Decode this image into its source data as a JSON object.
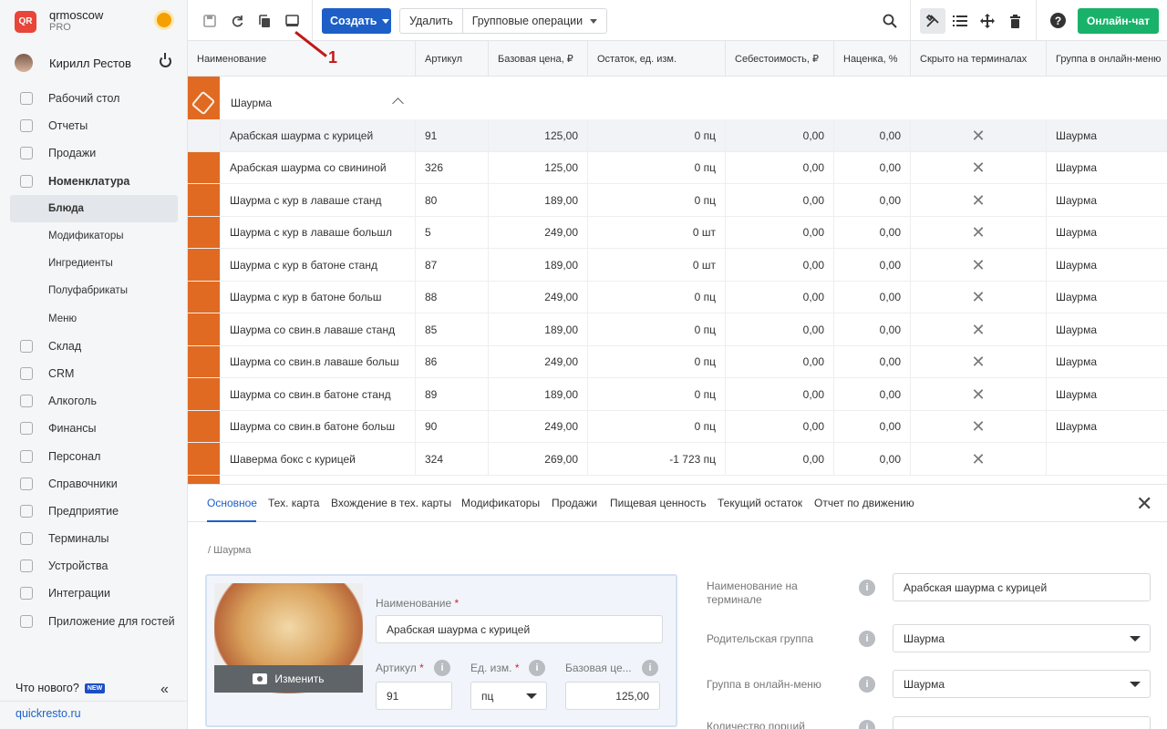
{
  "app": {
    "brand_name": "qrmoscow",
    "brand_plan": "PRO",
    "logo_text": "QR",
    "user_name": "Кирилл Рестов"
  },
  "sidebar": {
    "items": [
      {
        "label": "Рабочий стол",
        "icon": "desktop-icon"
      },
      {
        "label": "Отчеты",
        "icon": "reports-icon"
      },
      {
        "label": "Продажи",
        "icon": "basket-icon"
      },
      {
        "label": "Номенклатура",
        "icon": "tag-icon"
      },
      {
        "label": "Блюда",
        "sub": true,
        "active": true
      },
      {
        "label": "Модификаторы",
        "sub": true
      },
      {
        "label": "Ингредиенты",
        "sub": true
      },
      {
        "label": "Полуфабрикаты",
        "sub": true
      },
      {
        "label": "Меню",
        "sub": true
      },
      {
        "label": "Склад",
        "icon": "warehouse-icon"
      },
      {
        "label": "CRM",
        "icon": "crm-icon"
      },
      {
        "label": "Алкоголь",
        "icon": "glass-icon"
      },
      {
        "label": "Финансы",
        "icon": "wallet-icon"
      },
      {
        "label": "Персонал",
        "icon": "people-icon"
      },
      {
        "label": "Справочники",
        "icon": "book-icon"
      },
      {
        "label": "Предприятие",
        "icon": "store-icon"
      },
      {
        "label": "Терминалы",
        "icon": "terminal-icon"
      },
      {
        "label": "Устройства",
        "icon": "printer-icon"
      },
      {
        "label": "Интеграции",
        "icon": "infinity-icon"
      },
      {
        "label": "Приложение для гостей",
        "icon": "phone-icon"
      }
    ],
    "whats_new": "Что нового?",
    "new_badge": "NEW",
    "collapse": "«",
    "site_link": "quickresto.ru"
  },
  "toolbar": {
    "create_label": "Создать",
    "delete_label": "Удалить",
    "group_ops_label": "Групповые операции",
    "chat_label": "Онлайн-чат",
    "help": "?"
  },
  "annotation": {
    "label": "1"
  },
  "table": {
    "headers": [
      "Наименование",
      "Артикул",
      "Базовая цена, ₽",
      "Остаток, ед. изм.",
      "Себестоимость, ₽",
      "Наценка, %",
      "Скрыто на терминалах",
      "Группа в онлайн-меню"
    ],
    "group_label": "Шаурма",
    "rows": [
      {
        "name": "Арабская шаурма с курицей",
        "sku": "91",
        "price": "125,00",
        "stock": "0 пц",
        "cost": "0,00",
        "markup": "0,00",
        "group": "Шаурма"
      },
      {
        "name": "Арабская шаурма со свининой",
        "sku": "326",
        "price": "125,00",
        "stock": "0 пц",
        "cost": "0,00",
        "markup": "0,00",
        "group": "Шаурма"
      },
      {
        "name": "Шаурма с кур в лаваше станд",
        "sku": "80",
        "price": "189,00",
        "stock": "0 пц",
        "cost": "0,00",
        "markup": "0,00",
        "group": "Шаурма"
      },
      {
        "name": "Шаурма с кур в лаваше большл",
        "sku": "5",
        "price": "249,00",
        "stock": "0 шт",
        "cost": "0,00",
        "markup": "0,00",
        "group": "Шаурма"
      },
      {
        "name": "Шаурма с кур в батоне станд",
        "sku": "87",
        "price": "189,00",
        "stock": "0 шт",
        "cost": "0,00",
        "markup": "0,00",
        "group": "Шаурма"
      },
      {
        "name": "Шаурма с кур в батоне больш",
        "sku": "88",
        "price": "249,00",
        "stock": "0 пц",
        "cost": "0,00",
        "markup": "0,00",
        "group": "Шаурма"
      },
      {
        "name": "Шаурма со свин.в лаваше станд",
        "sku": "85",
        "price": "189,00",
        "stock": "0 пц",
        "cost": "0,00",
        "markup": "0,00",
        "group": "Шаурма"
      },
      {
        "name": "Шаурма со свин.в лаваше больш",
        "sku": "86",
        "price": "249,00",
        "stock": "0 пц",
        "cost": "0,00",
        "markup": "0,00",
        "group": "Шаурма"
      },
      {
        "name": "Шаурма со свин.в батоне станд",
        "sku": "89",
        "price": "189,00",
        "stock": "0 пц",
        "cost": "0,00",
        "markup": "0,00",
        "group": "Шаурма"
      },
      {
        "name": "Шаурма со свин.в батоне больш",
        "sku": "90",
        "price": "249,00",
        "stock": "0 пц",
        "cost": "0,00",
        "markup": "0,00",
        "group": "Шаурма"
      },
      {
        "name": "Шаверма бокс с курицей",
        "sku": "324",
        "price": "269,00",
        "stock": "-1 723 пц",
        "cost": "0,00",
        "markup": "0,00",
        "group": ""
      }
    ]
  },
  "detail": {
    "tabs": [
      "Основное",
      "Тех. карта",
      "Вхождение в тех. карты",
      "Модификаторы",
      "Продажи",
      "Пищевая ценность",
      "Текущий остаток",
      "Отчет по движению"
    ],
    "breadcrumb": "/ Шаурма",
    "change_photo": "Изменить",
    "name_label": "Наименование",
    "name_value": "Арабская шаурма с курицей",
    "sku_label": "Артикул",
    "sku_value": "91",
    "unit_label": "Ед. изм.",
    "unit_value": "пц",
    "price_label": "Базовая це...",
    "price_value": "125,00",
    "terminal_name_label": "Наименование на терминале",
    "terminal_name_value": "Арабская шаурма с курицей",
    "parent_group_label": "Родительская группа",
    "parent_group_value": "Шаурма",
    "online_group_label": "Группа в онлайн-меню",
    "online_group_value": "Шаурма",
    "portions_label": "Количество порций",
    "required_mark": "*",
    "info": "i"
  }
}
